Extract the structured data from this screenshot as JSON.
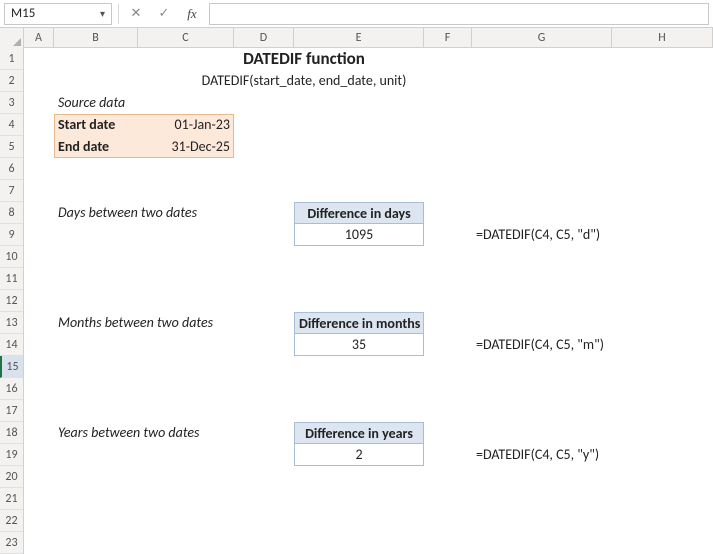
{
  "nameBox": "M15",
  "formulaInput": "",
  "columns": [
    "A",
    "B",
    "C",
    "D",
    "E",
    "F",
    "G",
    "H"
  ],
  "rowCount": 23,
  "activeRow": 15,
  "title": "DATEDIF function",
  "syntax": "DATEDIF(start_date, end_date, unit)",
  "sourceHeader": "Source data",
  "source": {
    "startLabel": "Start date",
    "startVal": "01-Jan-23",
    "endLabel": "End date",
    "endVal": "31-Dec-25"
  },
  "sections": {
    "days": {
      "desc": "Days between two dates",
      "header": "Difference in days",
      "value": "1095",
      "formula": "=DATEDIF(C4, C5, \"d\")"
    },
    "months": {
      "desc": "Months between two dates",
      "header": "Difference in months",
      "value": "35",
      "formula": "=DATEDIF(C4, C5, \"m\")"
    },
    "years": {
      "desc": "Years between two dates",
      "header": "Difference in years",
      "value": "2",
      "formula": "=DATEDIF(C4, C5, \"y\")"
    }
  },
  "chart_data": {
    "type": "table",
    "title": "DATEDIF function",
    "inputs": {
      "start_date": "01-Jan-23",
      "end_date": "31-Dec-25"
    },
    "rows": [
      {
        "unit": "d",
        "label": "Difference in days",
        "result": 1095,
        "formula": "=DATEDIF(C4, C5, \"d\")"
      },
      {
        "unit": "m",
        "label": "Difference in months",
        "result": 35,
        "formula": "=DATEDIF(C4, C5, \"m\")"
      },
      {
        "unit": "y",
        "label": "Difference in years",
        "result": 2,
        "formula": "=DATEDIF(C4, C5, \"y\")"
      }
    ]
  }
}
